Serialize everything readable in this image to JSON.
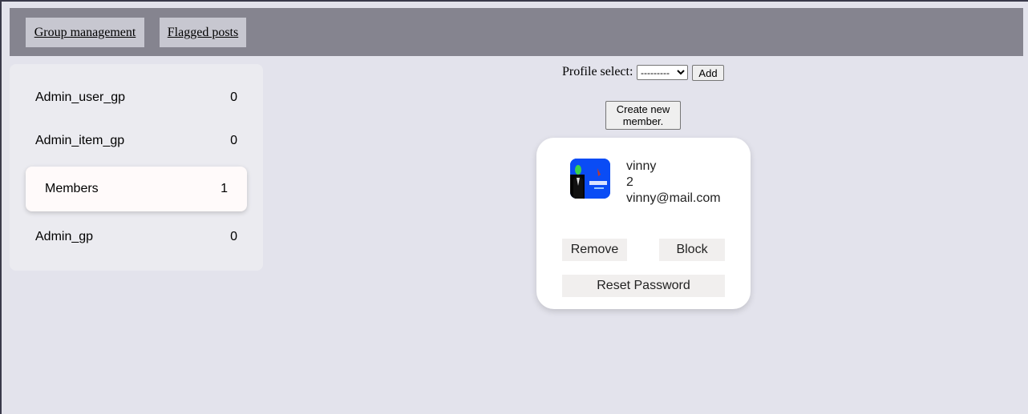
{
  "nav": {
    "group_management": "Group management",
    "flagged_posts": "Flagged posts"
  },
  "groups": [
    {
      "name": "Admin_user_gp",
      "count": "0",
      "active": false
    },
    {
      "name": "Admin_item_gp",
      "count": "0",
      "active": false
    },
    {
      "name": "Members",
      "count": "1",
      "active": true
    },
    {
      "name": "Admin_gp",
      "count": "0",
      "active": false
    }
  ],
  "profile_select": {
    "label": "Profile select:",
    "selected": "---------",
    "add_label": "Add"
  },
  "create_member_label": "Create new member.",
  "member": {
    "name": "vinny",
    "id": "2",
    "email": "vinny@mail.com",
    "avatar_icon": "profile-picture",
    "remove_label": "Remove",
    "block_label": "Block",
    "reset_password_label": "Reset Password"
  },
  "colors": {
    "background": "#e3e3ec",
    "topbar": "#85848f",
    "sidebar": "#ebebf0",
    "active_item": "#fffafa",
    "avatar_bg": "#0a4cf5"
  }
}
